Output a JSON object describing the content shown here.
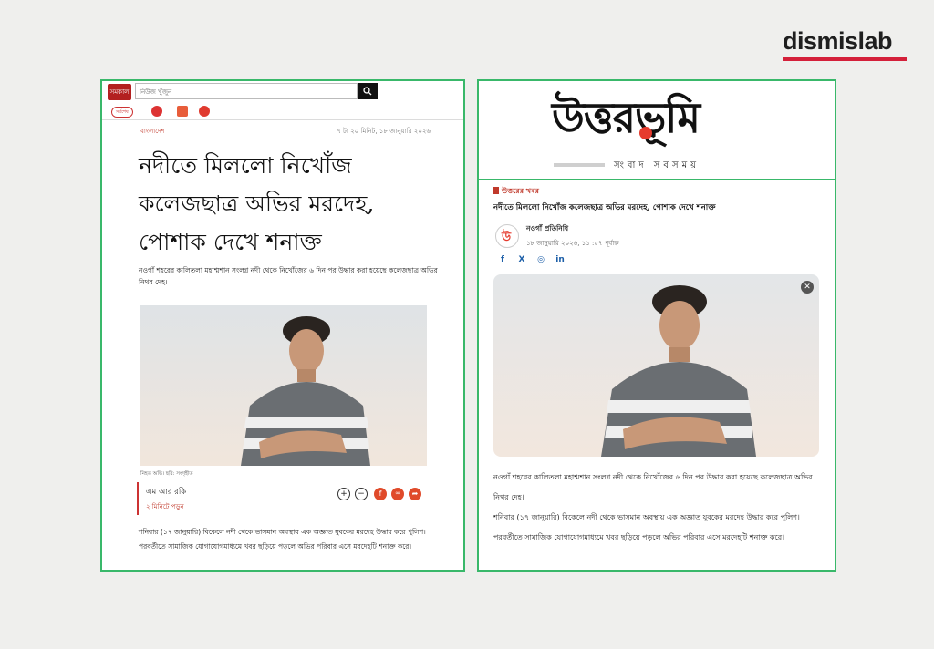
{
  "brand": {
    "name": "dismislab"
  },
  "left_panel": {
    "logo_text": "সমকাল",
    "search_placeholder": "নিউজ খুঁজুন",
    "search_icon": "search-icon",
    "nav_chip": "সর্বশেষ",
    "category": "বাংলাদেশ",
    "date": "৭ টা ২০ মিনিট, ১৮ জানুয়ারি ২০২৬",
    "headline_lines": [
      "নদীতে মিললো নিখোঁজ",
      "কলেজছাত্র অভির মরদেহ,",
      "পোশাক দেখে শনাক্ত"
    ],
    "lead": "নওগাঁ শহরের কালিতলা মহাশ্মশান সংলগ্ন নদী থেকে নিখোঁজের ৬ দিন পর উদ্ধার করা হয়েছে কলেজছাত্র অভির নিথর দেহ।",
    "caption": "নিহত অভি। ছবি: সংগৃহীত",
    "author": "এম আর রকি",
    "read_time": "২ মিনিটে পড়ুন",
    "share_icons": [
      "zoom-in-icon",
      "zoom-out-icon",
      "facebook-icon",
      "link-icon",
      "share-icon"
    ],
    "body": "শনিবার (১৭ জানুয়ারি) বিকেলে নদী থেকে ভাসমান অবস্থায় এক অজ্ঞাত যুবকের মরদেহ উদ্ধার করে পুলিশ। পরবর্তীতে সামাজিক যোগাযোগমাধ্যমে খবর ছড়িয়ে পড়লে অভির পরিবার এসে মরদেহটি শনাক্ত করে।"
  },
  "right_panel": {
    "logo": "উত্তরভূমি",
    "tagline": "সংবাদ সবসময়",
    "category": "উত্তরের খবর",
    "title": "নদীতে মিললো নিখোঁজ কলেজছাত্র অভির মরদেহ, পোশাক দেখে শনাক্ত",
    "avatar_letter": "উ",
    "byline": "নওগাঁ প্রতিনিধি",
    "time": "১৮ জানুয়ারি ২০২৬, ১১ :৫৭ পূর্বাহ্ন",
    "social": [
      {
        "label": "f",
        "icon": "facebook-icon"
      },
      {
        "label": "X",
        "icon": "x-icon"
      },
      {
        "label": "◎",
        "icon": "whatsapp-icon"
      },
      {
        "label": "in",
        "icon": "linkedin-icon"
      }
    ],
    "para1": "নওগাঁ শহরের কালিতলা মহাশ্মশান সংলগ্ন নদী থেকে নিখোঁজের ৬ দিন পর উদ্ধার করা হয়েছে কলেজছাত্র অভির নিথর দেহ।",
    "para2": "শনিবার (১৭ জানুয়ারি) বিকেলে নদী থেকে ভাসমান অবস্থায় এক অজ্ঞাত যুবকের মরদেহ উদ্ধার করে পুলিশ। পরবর্তীতে সামাজিক যোগাযোগমাধ্যমে খবর ছড়িয়ে পড়লে অভির পরিবার এসে মরদেহটি শনাক্ত করে।"
  },
  "colors": {
    "accent_red": "#d4203a",
    "frame_green": "#39b86a"
  }
}
